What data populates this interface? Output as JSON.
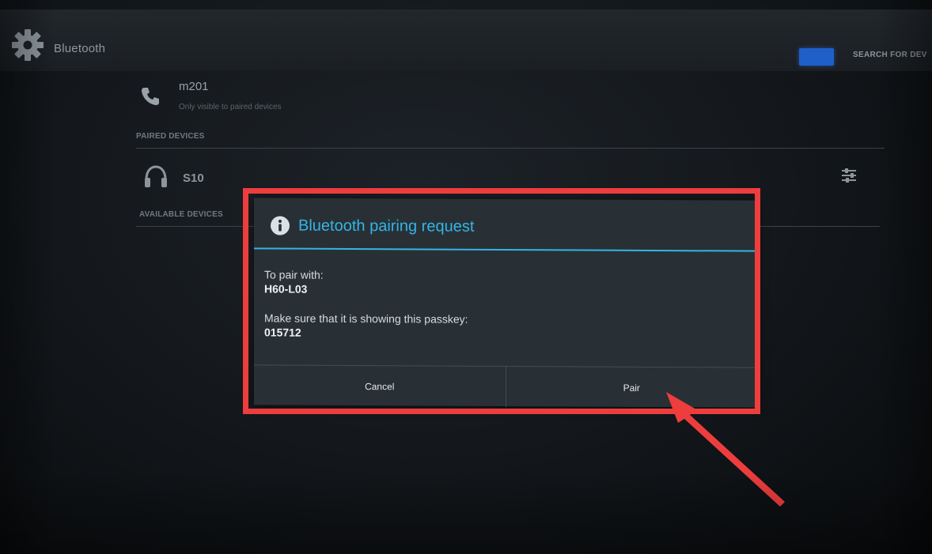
{
  "action_bar": {
    "title": "Bluetooth",
    "search_label": "SEARCH FOR DEV"
  },
  "local_device": {
    "name": "m201",
    "visibility": "Only visible to paired devices"
  },
  "paired_section": {
    "header": "PAIRED DEVICES",
    "devices": [
      {
        "name": "S10",
        "icon": "headset-icon"
      }
    ]
  },
  "available_section": {
    "header": "AVAILABLE DEVICES"
  },
  "dialog": {
    "title": "Bluetooth pairing request",
    "pair_with_label": "To pair with:",
    "device_name": "H60-L03",
    "passkey_label": "Make sure that it is showing this passkey:",
    "passkey": "015712",
    "cancel_label": "Cancel",
    "pair_label": "Pair"
  },
  "colors": {
    "accent": "#33b5e5",
    "annotation": "#ee3d3d",
    "toggle": "#1f5fc8"
  }
}
